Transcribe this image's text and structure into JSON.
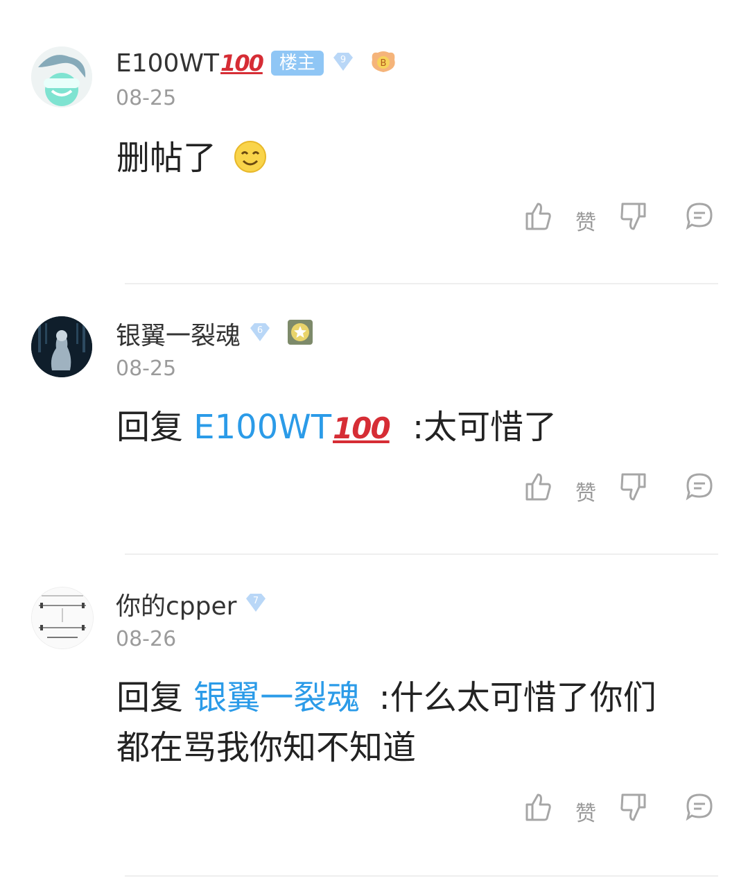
{
  "comments": [
    {
      "username": "E100WT",
      "emoji_suffix": "100",
      "owner_badge": "楼主",
      "level": "9",
      "date": "08-25",
      "text": "删帖了",
      "like_label": "赞"
    },
    {
      "username": "银翼一裂魂",
      "level": "6",
      "date": "08-25",
      "reply_prefix": "回复",
      "reply_to": "E100WT",
      "reply_to_emoji": "100",
      "text": ":太可惜了",
      "like_label": "赞"
    },
    {
      "username": "你的cpper",
      "level": "7",
      "date": "08-26",
      "reply_prefix": "回复",
      "reply_to": "银翼一裂魂",
      "text_line1": ":什么太可惜了你们",
      "text_line2": "都在骂我你知不知道",
      "like_label": "赞"
    }
  ],
  "colors": {
    "link": "#2b9be8",
    "owner_badge_bg": "#8fc6f5",
    "date": "#9b9b9b"
  }
}
